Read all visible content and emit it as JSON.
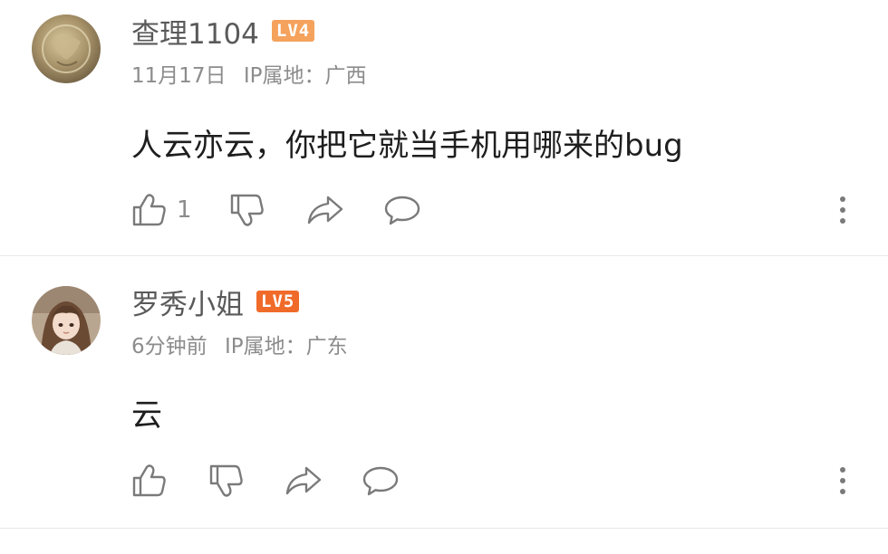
{
  "colors": {
    "badge_lv4": "#f5a25d",
    "badge_lv5": "#f06b2a",
    "icon": "#7a7a7a",
    "meta": "#8c8c8c"
  },
  "comments": [
    {
      "username": "查理1104",
      "level": "LV4",
      "date": "11月17日",
      "ip_location": "IP属地：广西",
      "text": "人云亦云，你把它就当手机用哪来的bug",
      "like_count": "1",
      "icons": [
        "thumbs-up-icon",
        "thumbs-down-icon",
        "share-icon",
        "reply-bubble-icon",
        "more-vertical-icon"
      ]
    },
    {
      "username": "罗秀小姐",
      "level": "LV5",
      "date": "6分钟前",
      "ip_location": "IP属地：广东",
      "text": "云",
      "like_count": "",
      "icons": [
        "thumbs-up-icon",
        "thumbs-down-icon",
        "share-icon",
        "reply-bubble-icon",
        "more-vertical-icon"
      ]
    }
  ]
}
